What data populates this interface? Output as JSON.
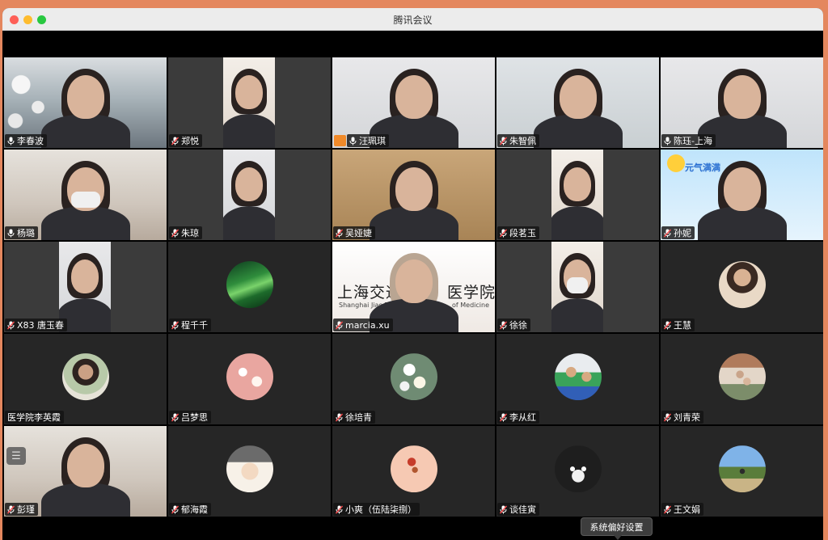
{
  "window": {
    "title": "腾讯会议"
  },
  "participants": [
    {
      "name": "李春波",
      "mic": "on",
      "kind": "video-full",
      "bg": "bg-a"
    },
    {
      "name": "郑悦",
      "mic": "muted",
      "kind": "video-narrow",
      "bg": "bg-c"
    },
    {
      "name": "汪珮琪",
      "mic": "on",
      "kind": "video-full",
      "bg": "bg-e",
      "host": true
    },
    {
      "name": "朱智佩",
      "mic": "muted",
      "kind": "video-full",
      "bg": "bg-d"
    },
    {
      "name": "陈珏-上海",
      "mic": "on",
      "kind": "video-full",
      "bg": "bg-e"
    },
    {
      "name": "杨璐",
      "mic": "on",
      "kind": "video-full",
      "bg": "bg-b",
      "masked": true
    },
    {
      "name": "朱琼",
      "mic": "muted",
      "kind": "video-narrow",
      "bg": "bg-e"
    },
    {
      "name": "吴娅婕",
      "mic": "muted",
      "kind": "video-full",
      "bg": "bg-f"
    },
    {
      "name": "段茗玉",
      "mic": "muted",
      "kind": "video-narrow",
      "bg": "bg-c"
    },
    {
      "name": "孙妮",
      "mic": "muted",
      "kind": "video-sky",
      "bg": "bg-sky",
      "sky_text": "元气满满"
    },
    {
      "name": "X83 唐玉春",
      "mic": "muted",
      "kind": "video-narrow",
      "bg": "bg-e"
    },
    {
      "name": "程千千",
      "mic": "muted",
      "kind": "avatar",
      "avatar": "av-green"
    },
    {
      "name": "marcia.xu",
      "mic": "muted",
      "kind": "video-sign",
      "bg": "bg-sign",
      "sign_text": "上海交通",
      "sign_text_right": "医学院",
      "sign_sub_left": "Shanghai Jiao Tong",
      "sign_sub_right": "of Medicine"
    },
    {
      "name": "徐徐",
      "mic": "muted",
      "kind": "video-narrow",
      "bg": "bg-c",
      "masked": true
    },
    {
      "name": "王慧",
      "mic": "muted",
      "kind": "avatar",
      "avatar": "av-woman1"
    },
    {
      "name": "医学院李英霞",
      "mic": "none",
      "kind": "avatar",
      "avatar": "av-woman2"
    },
    {
      "name": "吕梦思",
      "mic": "muted",
      "kind": "avatar",
      "avatar": "av-flower1"
    },
    {
      "name": "徐培青",
      "mic": "muted",
      "kind": "avatar",
      "avatar": "av-flower2"
    },
    {
      "name": "李从红",
      "mic": "muted",
      "kind": "avatar",
      "avatar": "av-kids"
    },
    {
      "name": "刘青荣",
      "mic": "muted",
      "kind": "avatar",
      "avatar": "av-family"
    },
    {
      "name": "彭瑾",
      "mic": "muted",
      "kind": "video-full",
      "bg": "bg-b",
      "side_button": true
    },
    {
      "name": "郁海霞",
      "mic": "muted",
      "kind": "avatar",
      "avatar": "av-cartoon"
    },
    {
      "name": "小爽（伍陆柒捌）",
      "mic": "muted",
      "kind": "avatar",
      "avatar": "av-girl"
    },
    {
      "name": "谈佳寅",
      "mic": "muted",
      "kind": "avatar",
      "avatar": "av-cat"
    },
    {
      "name": "王文娟",
      "mic": "muted",
      "kind": "avatar",
      "avatar": "av-outdoor"
    }
  ],
  "tooltip": {
    "text": "系统偏好设置"
  },
  "colors": {
    "mic_on": "#ffffff",
    "mic_muted": "#ff4d4f",
    "host_badge": "#f08a2a"
  }
}
